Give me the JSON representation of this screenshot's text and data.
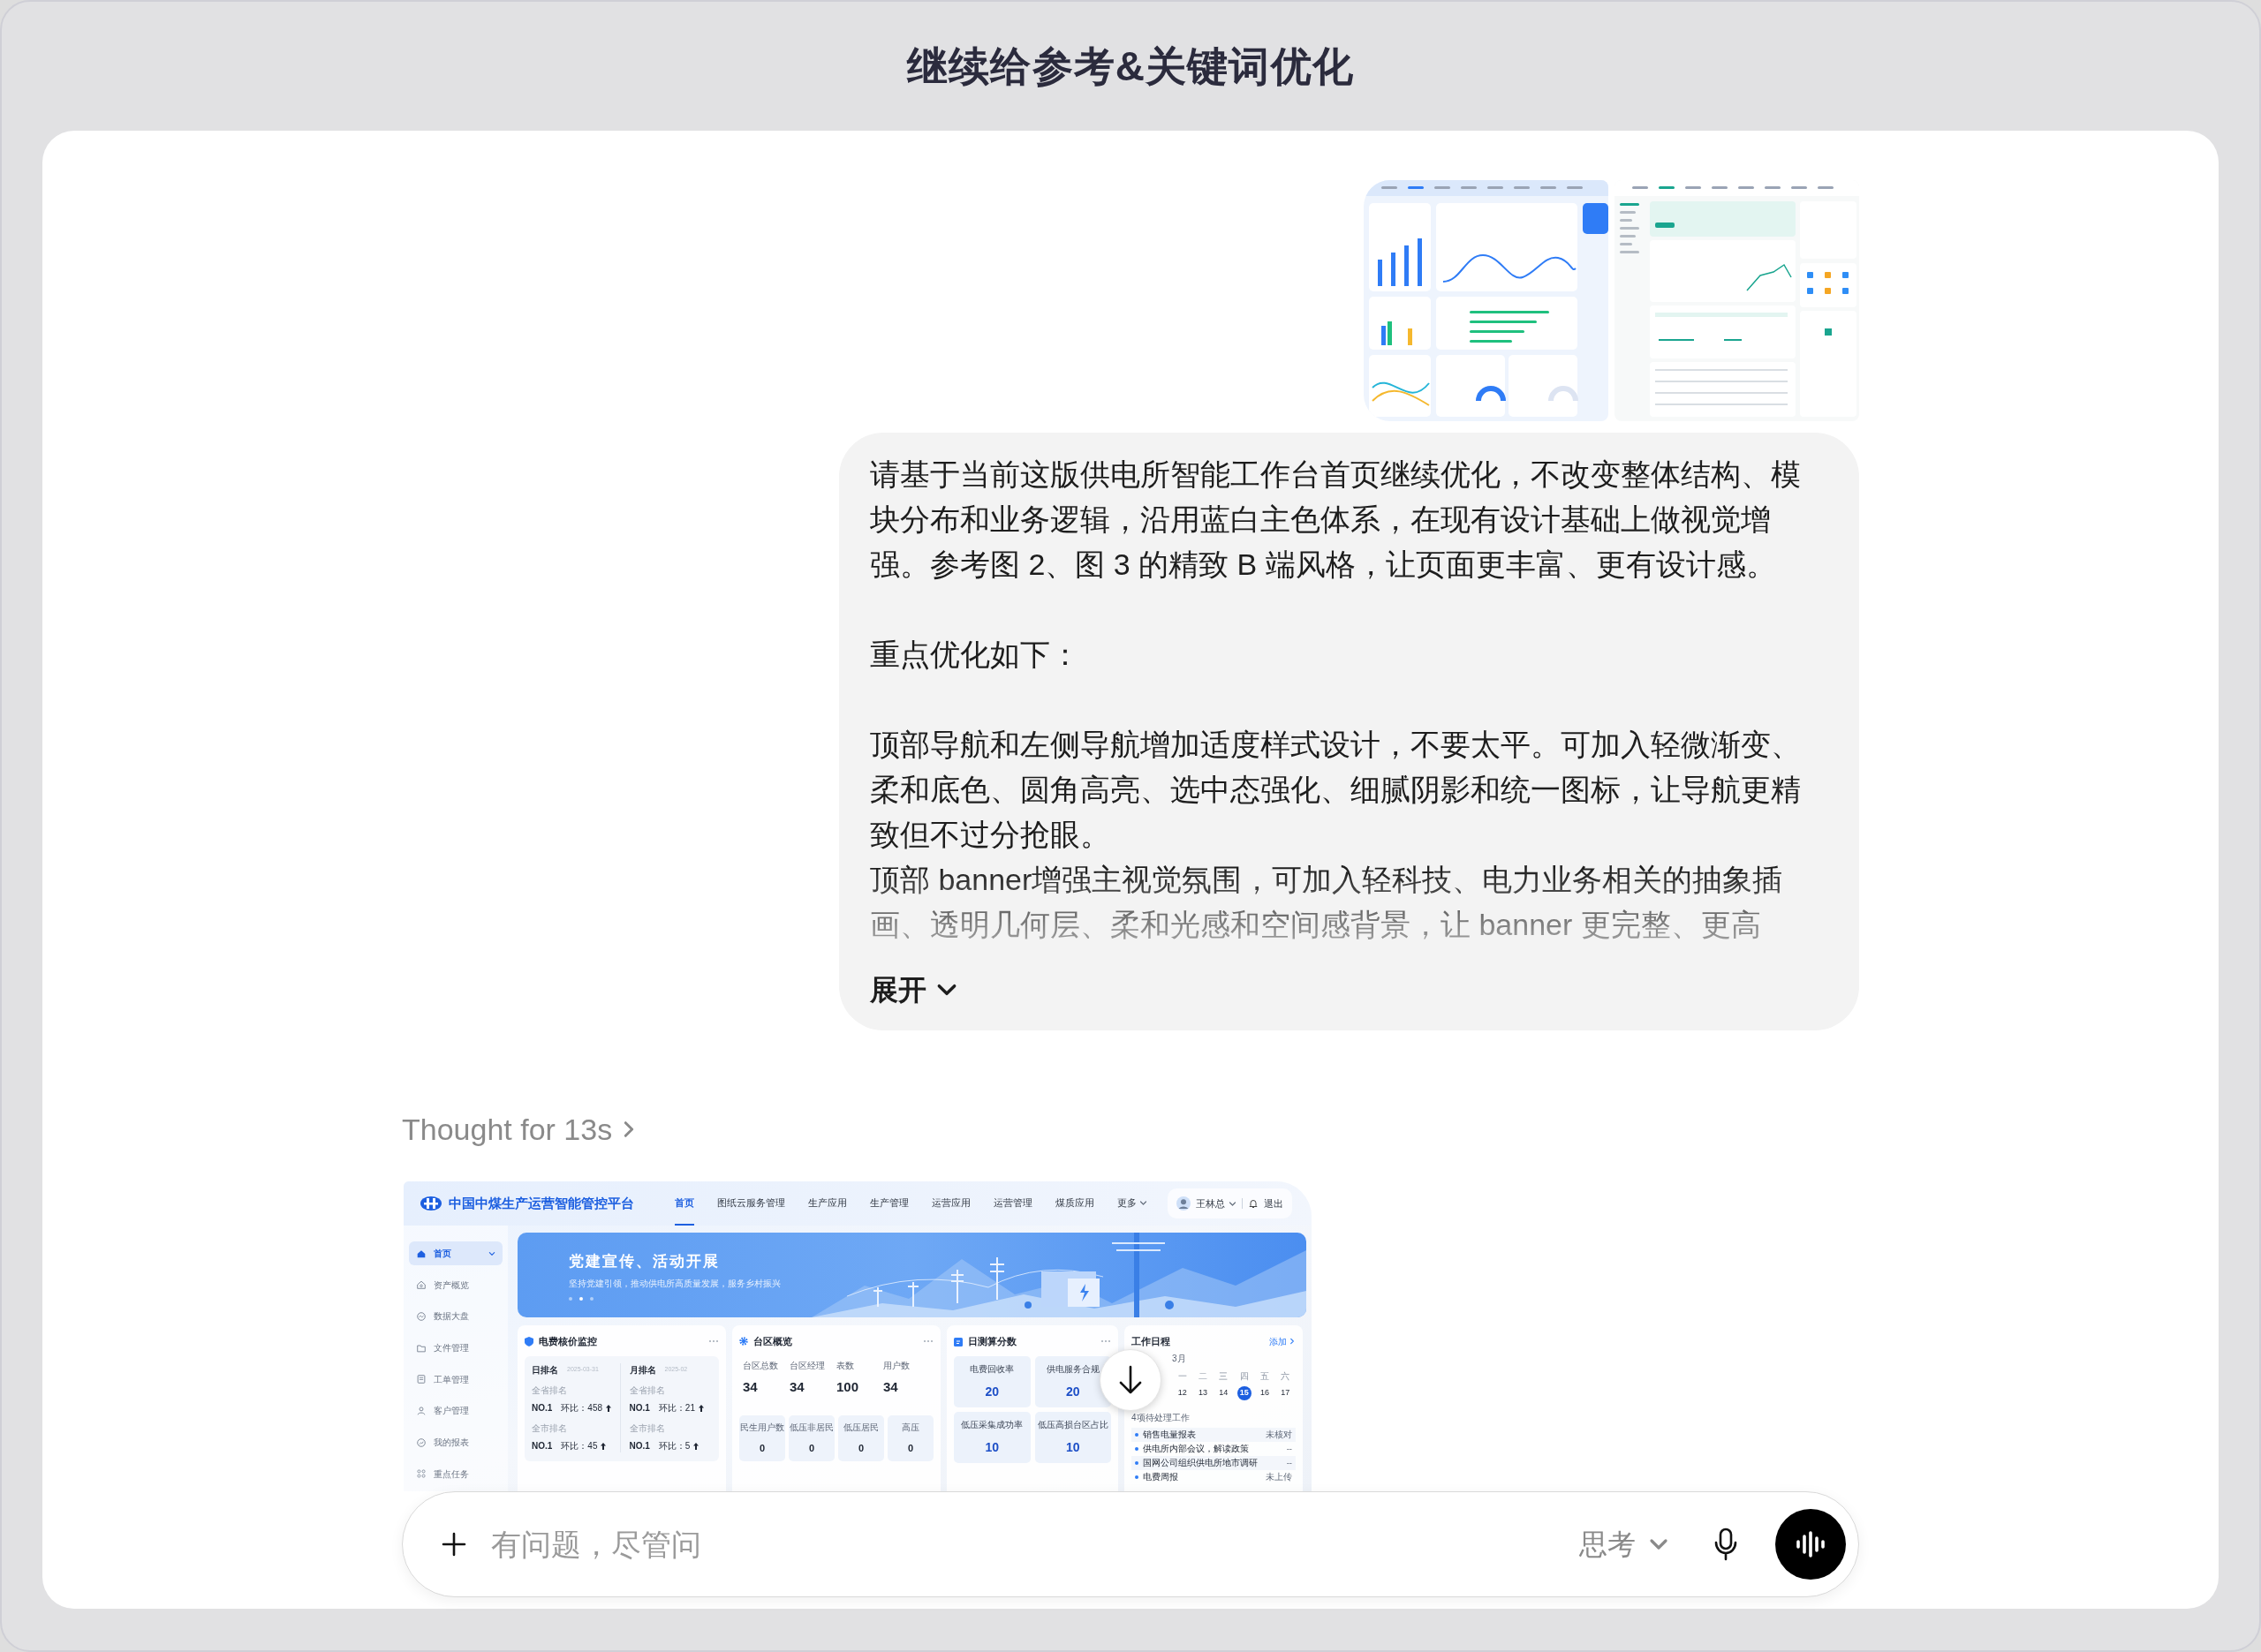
{
  "title": "继续给参考&关键词优化",
  "attachments": [
    {
      "kind": "blue"
    },
    {
      "kind": "teal"
    }
  ],
  "message": {
    "sections": [
      {
        "lines": [
          "请基于当前这版供电所智能工作台首页继续优化，不改变整体结构、模块分布和业务逻辑，沿用蓝白主色体系，在现有设计基础上做视觉增强。参考图 2、图 3 的精致 B 端风格，让页面更丰富、更有设计感。"
        ]
      },
      {
        "lines": [
          "重点优化如下："
        ]
      },
      {
        "lines": [
          "顶部导航和左侧导航增加适度样式设计，不要太平。可加入轻微渐变、柔和底色、圆角高亮、选中态强化、细腻阴影和统一图标，让导航更精致但不过分抢眼。",
          "顶部 banner增强主视觉氛围，可加入轻科技、电力业务相关的抽象插画、透明几何层、柔和光感和空间感背景，让 banner 更完整、更高"
        ]
      }
    ],
    "expand_label": "展开"
  },
  "thought": "Thought for 13s",
  "preview": {
    "app_title": "中国中煤生产运营智能管控平台",
    "nav": [
      {
        "label": "首页",
        "selected": true,
        "dropdown": false
      },
      {
        "label": "图纸云服务管理",
        "selected": false,
        "dropdown": false
      },
      {
        "label": "生产应用",
        "selected": false,
        "dropdown": false
      },
      {
        "label": "生产管理",
        "selected": false,
        "dropdown": false
      },
      {
        "label": "运营应用",
        "selected": false,
        "dropdown": false
      },
      {
        "label": "运营管理",
        "selected": false,
        "dropdown": false
      },
      {
        "label": "煤质应用",
        "selected": false,
        "dropdown": false
      },
      {
        "label": "更多",
        "selected": false,
        "dropdown": true
      }
    ],
    "user": {
      "name": "王林总",
      "logout": "退出"
    },
    "sidebar": [
      {
        "label": "首页",
        "selected": true
      },
      {
        "label": "资产概览",
        "selected": false
      },
      {
        "label": "数据大盘",
        "selected": false
      },
      {
        "label": "文件管理",
        "selected": false
      },
      {
        "label": "工单管理",
        "selected": false
      },
      {
        "label": "客户管理",
        "selected": false
      },
      {
        "label": "我的报表",
        "selected": false
      },
      {
        "label": "重点任务",
        "selected": false
      }
    ],
    "banner": {
      "title": "党建宣传、活动开展",
      "subtitle": "坚持党建引领，推动供电所高质量发展，服务乡村振兴",
      "dots": [
        {
          "selected": false
        },
        {
          "selected": true
        },
        {
          "selected": false
        }
      ]
    },
    "billing_card": {
      "title": "电费核价监控",
      "columns": [
        {
          "heading": "日排名",
          "date": "2025-03-31",
          "groups": [
            {
              "label": "全省排名",
              "rank": "NO.1",
              "change": "环比：458"
            },
            {
              "label": "全市排名",
              "rank": "NO.1",
              "change": "环比：45"
            }
          ]
        },
        {
          "heading": "月排名",
          "date": "2025-02",
          "groups": [
            {
              "label": "全省排名",
              "rank": "NO.1",
              "change": "环比：21"
            },
            {
              "label": "全市排名",
              "rank": "NO.1",
              "change": "环比：5"
            }
          ]
        }
      ]
    },
    "area_card": {
      "title": "台区概览",
      "stats": [
        {
          "label": "台区总数",
          "value": "34"
        },
        {
          "label": "台区经理",
          "value": "34"
        },
        {
          "label": "表数",
          "value": "100"
        },
        {
          "label": "用户数",
          "value": "34"
        }
      ],
      "tiles": [
        {
          "label": "民生用户数",
          "value": "0"
        },
        {
          "label": "低压非居民",
          "value": "0"
        },
        {
          "label": "低压居民",
          "value": "0"
        },
        {
          "label": "高压",
          "value": "0"
        }
      ]
    },
    "score_card": {
      "title": "日测算分数",
      "tiles": [
        {
          "label": "电费回收率",
          "value": "20"
        },
        {
          "label": "供电服务合规",
          "value": "20"
        },
        {
          "label": "低压采集成功率",
          "value": "10"
        },
        {
          "label": "低压高损台区占比",
          "value": "10"
        }
      ]
    },
    "schedule_card": {
      "title": "工作日程",
      "add_label": "添加",
      "month": "3月",
      "weekdays": [
        "一",
        "二",
        "三",
        "四",
        "五",
        "六"
      ],
      "days": [
        {
          "label": "12",
          "selected": false
        },
        {
          "label": "13",
          "selected": false
        },
        {
          "label": "14",
          "selected": false
        },
        {
          "label": "15",
          "selected": true
        },
        {
          "label": "16",
          "selected": false
        },
        {
          "label": "17",
          "selected": false
        }
      ],
      "pending": "4项待处理工作",
      "tasks": [
        {
          "title": "销售电量报表",
          "status": "未核对"
        },
        {
          "title": "供电所内部会议，解读政策",
          "status": "--"
        },
        {
          "title": "国网公司组织供电所地市调研",
          "status": "--"
        },
        {
          "title": "电费周报",
          "status": "未上传"
        }
      ]
    }
  },
  "composer": {
    "placeholder": "有问题，尽管问",
    "mode": "思考"
  }
}
